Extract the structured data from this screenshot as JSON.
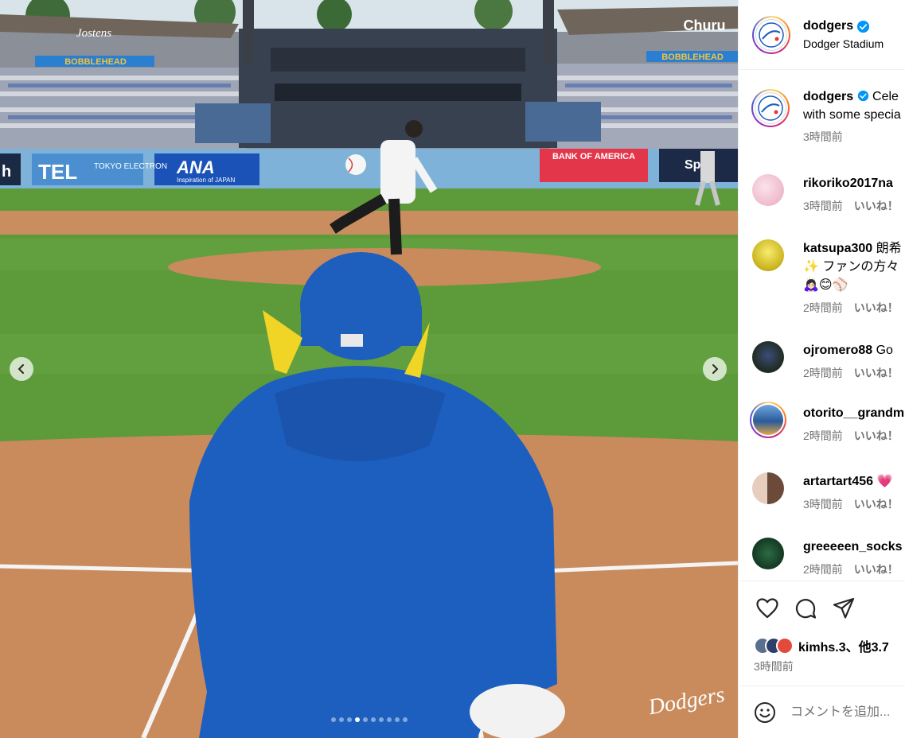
{
  "post": {
    "username": "dodgers",
    "location": "Dodger Stadium",
    "carousel": {
      "total_slides": 10,
      "current_slide": 4
    }
  },
  "media": {
    "signage": {
      "jostens": "Jostens",
      "bobblehead": "BOBBLEHEAD",
      "tel": "TEL",
      "tokyo_electron": "TOKYO ELECTRON",
      "ana": "ANA",
      "ana_tagline": "Inspiration of JAPAN",
      "bank_of_america": "BANK OF AMERICA",
      "churu": "Churu",
      "sports": "Sp",
      "left_edge": "h"
    },
    "watermark": "Dodgers"
  },
  "caption": {
    "username": "dodgers",
    "text_line1": "Cele",
    "text_line2": "with some specia",
    "time": "3時間前"
  },
  "comments": [
    {
      "username": "rikoriko2017na",
      "text": "",
      "time": "3時間前",
      "like_label": "いいね！",
      "avatar_color": "#f0c4d4"
    },
    {
      "username": "katsupa300",
      "text": "朗希",
      "text2": "✨ ファンの方々",
      "text3": "🙇🏻‍♀️😊⚾",
      "time": "2時間前",
      "like_label": "いいね！",
      "avatar_color": "#f3e04a"
    },
    {
      "username": "ojromero88",
      "text": "Go",
      "time": "2時間前",
      "like_label": "いいね！",
      "avatar_color": "#2e3a2a"
    },
    {
      "username": "otorito__grandm",
      "text": "",
      "time": "2時間前",
      "like_label": "いいね！",
      "avatar_color": "#3b7bbf"
    },
    {
      "username": "artartart456",
      "text": "💗",
      "time": "3時間前",
      "like_label": "いいね！",
      "avatar_color": "#c9a48f"
    },
    {
      "username": "greeeeen_socks",
      "text": "",
      "time": "2時間前",
      "like_label": "いいね！",
      "avatar_color": "#1e4a2e"
    }
  ],
  "actions": {
    "likes_text": "kimhs.3、他3.7",
    "post_time": "3時間前",
    "comment_placeholder": "コメントを追加..."
  }
}
